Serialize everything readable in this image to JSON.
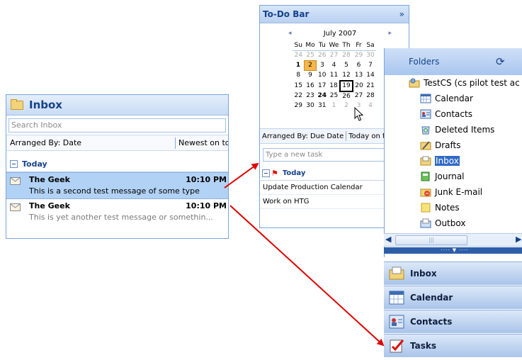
{
  "inbox": {
    "title": "Inbox",
    "search_placeholder": "Search Inbox",
    "arranged_by": "Arranged By: Date",
    "sort_order": "Newest on top",
    "group": "Today",
    "messages": [
      {
        "from": "The Geek",
        "time": "10:10 PM",
        "subject": "This is a second test message of some type"
      },
      {
        "from": "The Geek",
        "time": "10:10 PM",
        "subject": "This is yet another test message or somethin..."
      }
    ]
  },
  "todo_bar": {
    "title": "To-Do Bar",
    "chevron": "»",
    "calendar": {
      "month": "July 2007",
      "prev": "◂",
      "next": "▸",
      "dow": [
        "Su",
        "Mo",
        "Tu",
        "We",
        "Th",
        "Fr",
        "Sa"
      ],
      "weeks": [
        [
          "24",
          "25",
          "26",
          "27",
          "28",
          "29",
          "30"
        ],
        [
          "1",
          "2",
          "3",
          "4",
          "5",
          "6",
          "7"
        ],
        [
          "8",
          "9",
          "10",
          "11",
          "12",
          "13",
          "14"
        ],
        [
          "15",
          "16",
          "17",
          "18",
          "19",
          "20",
          "21"
        ],
        [
          "22",
          "23",
          "24",
          "25",
          "26",
          "27",
          "28"
        ],
        [
          "29",
          "30",
          "31",
          "1",
          "2",
          "3",
          "4"
        ]
      ]
    },
    "arranged_by": "Arranged By: Due Date",
    "sort_order": "Today on top",
    "new_task_placeholder": "Type a new task",
    "group": "Today",
    "tasks": [
      {
        "name": "Update Production Calendar"
      },
      {
        "name": "Work on HTG"
      }
    ]
  },
  "navigation": {
    "folders_title": "Folders",
    "mailbox": "TestCS (cs pilot test ac",
    "folders": [
      "Calendar",
      "Contacts",
      "Deleted Items",
      "Drafts",
      "Inbox",
      "Journal",
      "Junk E-mail",
      "Notes",
      "Outbox"
    ],
    "selected_folder": "Inbox",
    "splitter": "···· ▼ ····",
    "buttons": [
      "Inbox",
      "Calendar",
      "Contacts",
      "Tasks"
    ]
  },
  "colors": {
    "header_text": "#15428b",
    "selection": "#b2d2f5",
    "selected_date": "#f7b64a",
    "arrow": "#e00000"
  }
}
